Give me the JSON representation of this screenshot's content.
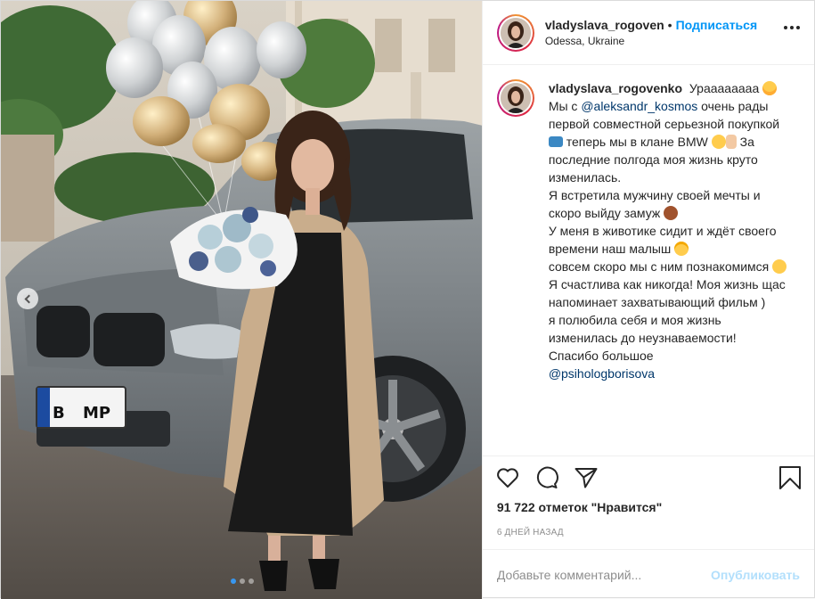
{
  "colors": {
    "accent": "#0095f6",
    "publish_disabled": "#b2dffc",
    "muted": "#8e8e8e"
  },
  "post": {
    "photo": {
      "plate_left": "B",
      "plate_right": "MP",
      "carousel_current": 1,
      "carousel_total": 3
    },
    "header": {
      "username": "vladyslava_rogoven",
      "separator": "•",
      "follow_label": "Подписаться",
      "location": "Odessa, Ukraine",
      "more_icon": "more-options-icon"
    },
    "caption": {
      "username": "vladyslava_rogovenko",
      "segments": {
        "s1": "Ураааааааа",
        "s2": "Мы с",
        "m1": "@aleksandr_kosmos",
        "s3": "очень рады первой совместной серьезной покупкой",
        "s4": "теперь мы в клане BMW",
        "s5": "За последние полгода моя жизнь круто изменилась.",
        "s6": "Я встретила мужчину своей мечты и скоро выйду замуж",
        "s7": "У меня в животике сидит и ждёт своего времени наш малыш",
        "s8": "совсем скоро мы с ним познакомимся",
        "s9": "Я счастлива как никогда! Моя жизнь щас напоминает захватывающий фильм )",
        "s10": "я полюбила себя и моя жизнь изменилась до неузнаваемости!",
        "s11": "Спасибо большое",
        "m2": "@psihologborisova"
      }
    },
    "actions": {
      "like_icon": "heart-icon",
      "comment_icon": "comment-icon",
      "share_icon": "share-icon",
      "save_icon": "bookmark-icon"
    },
    "likes_text": "91 722 отметок \"Нравится\"",
    "date_text": "6 дней назад",
    "comment_box": {
      "placeholder": "Добавьте комментарий...",
      "publish_label": "Опубликовать"
    }
  }
}
